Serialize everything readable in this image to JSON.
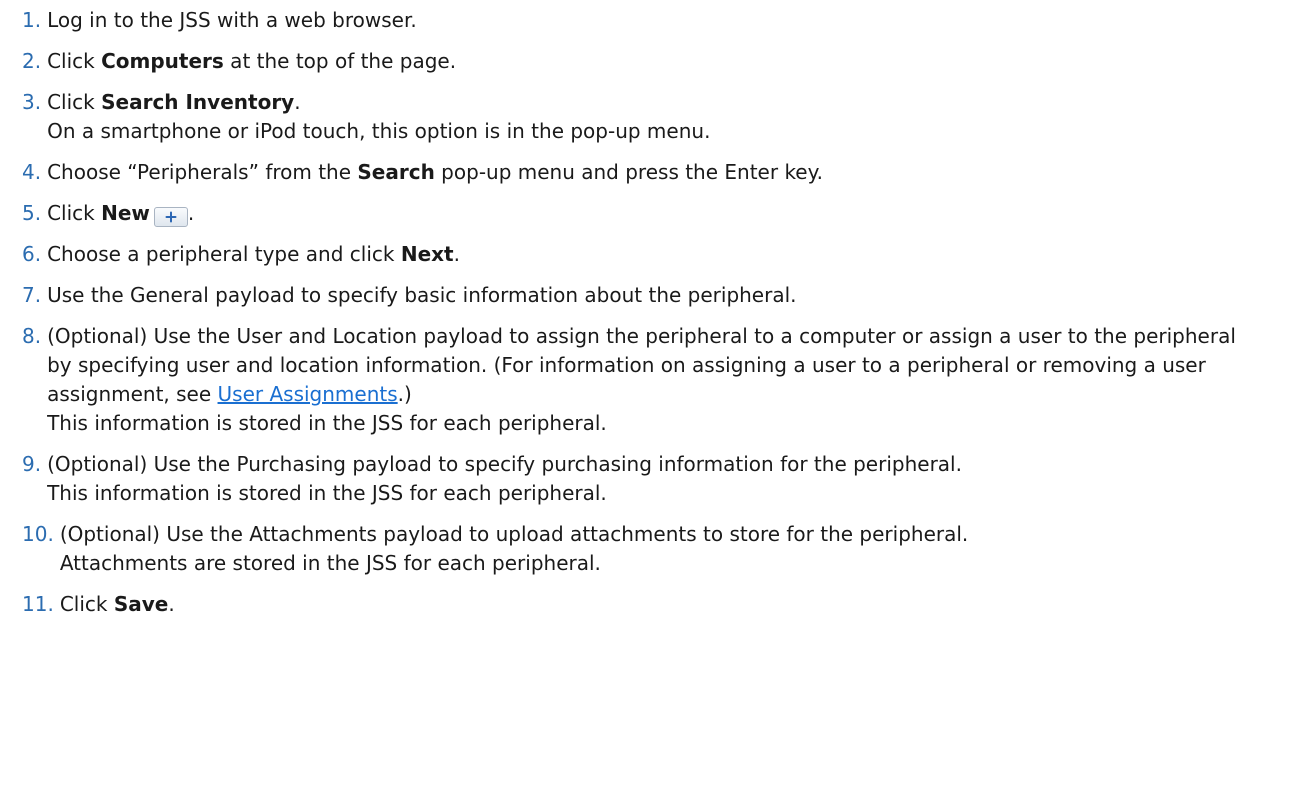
{
  "steps": [
    {
      "number": "1.",
      "parts": [
        "Log in to the JSS with a web browser."
      ]
    },
    {
      "number": "2.",
      "parts": [
        "Click ",
        "Computers",
        " at the top of the page."
      ]
    },
    {
      "number": "3.",
      "parts": [
        "Click ",
        "Search Inventory",
        "."
      ],
      "note": "On a smartphone or iPod touch, this option is in the pop-up menu."
    },
    {
      "number": "4.",
      "parts": [
        "Choose “Peripherals” from the ",
        "Search",
        " pop-up menu and press the Enter key."
      ]
    },
    {
      "number": "5.",
      "parts": [
        "Click ",
        "New",
        "."
      ],
      "button_icon": "plus-icon"
    },
    {
      "number": "6.",
      "parts": [
        "Choose a peripheral type and click ",
        "Next",
        "."
      ]
    },
    {
      "number": "7.",
      "parts": [
        "Use the General payload to specify basic information about the peripheral."
      ]
    },
    {
      "number": "8.",
      "parts": [
        "(Optional) Use the User and Location payload to assign the peripheral to a computer or assign a user to the peripheral by specifying user and location information. (For information on assigning a user to a peripheral or removing a user assignment, see ",
        "User Assignments",
        ".)"
      ],
      "note": "This information is stored in the JSS for each peripheral."
    },
    {
      "number": "9.",
      "parts": [
        "(Optional) Use the Purchasing payload to specify purchasing information for the peripheral."
      ],
      "note": "This information is stored in the JSS for each peripheral."
    },
    {
      "number": "10.",
      "parts": [
        "(Optional) Use the Attachments payload to upload attachments to store for the peripheral."
      ],
      "note": "Attachments are stored in the JSS for each peripheral."
    },
    {
      "number": "11.",
      "parts": [
        "Click ",
        "Save",
        "."
      ]
    }
  ],
  "colors": {
    "step_number": "#2b6cb0",
    "link": "#1a6fd1"
  }
}
